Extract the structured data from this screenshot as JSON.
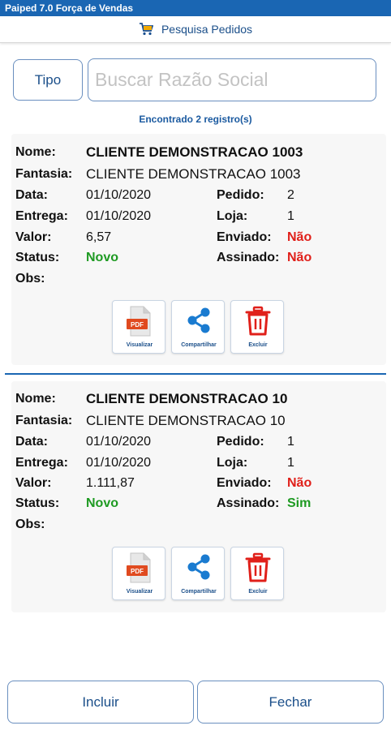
{
  "app": {
    "title": "Paiped 7.0 Força de Vendas"
  },
  "header": {
    "title": "Pesquisa Pedidos",
    "icon": "cart-icon"
  },
  "search": {
    "tipo_label": "Tipo",
    "placeholder": "Buscar Razão Social",
    "value": ""
  },
  "results": {
    "found_text": "Encontrado 2 registro(s)"
  },
  "labels": {
    "nome": "Nome:",
    "fantasia": "Fantasia:",
    "data": "Data:",
    "entrega": "Entrega:",
    "valor": "Valor:",
    "status": "Status:",
    "obs": "Obs:",
    "pedido": "Pedido:",
    "loja": "Loja:",
    "enviado": "Enviado:",
    "assinado": "Assinado:"
  },
  "actions": {
    "visualizar": "Visualizar",
    "compartilhar": "Compartilhar",
    "excluir": "Excluir",
    "pdf_tag": "PDF"
  },
  "orders": [
    {
      "nome": "CLIENTE DEMONSTRACAO 1003",
      "fantasia": "CLIENTE DEMONSTRACAO 1003",
      "data": "01/10/2020",
      "entrega": "01/10/2020",
      "valor": "6,57",
      "status": "Novo",
      "obs": "",
      "pedido": "2",
      "loja": "1",
      "enviado": "Não",
      "assinado": "Não"
    },
    {
      "nome": "CLIENTE DEMONSTRACAO 10",
      "fantasia": "CLIENTE DEMONSTRACAO 10",
      "data": "01/10/2020",
      "entrega": "01/10/2020",
      "valor": "1.111,87",
      "status": "Novo",
      "obs": "",
      "pedido": "1",
      "loja": "1",
      "enviado": "Não",
      "assinado": "Sim"
    }
  ],
  "footer": {
    "incluir": "Incluir",
    "fechar": "Fechar"
  },
  "colors": {
    "accent": "#1a66b3",
    "yes": "#1e9a22",
    "no": "#e0201a"
  }
}
